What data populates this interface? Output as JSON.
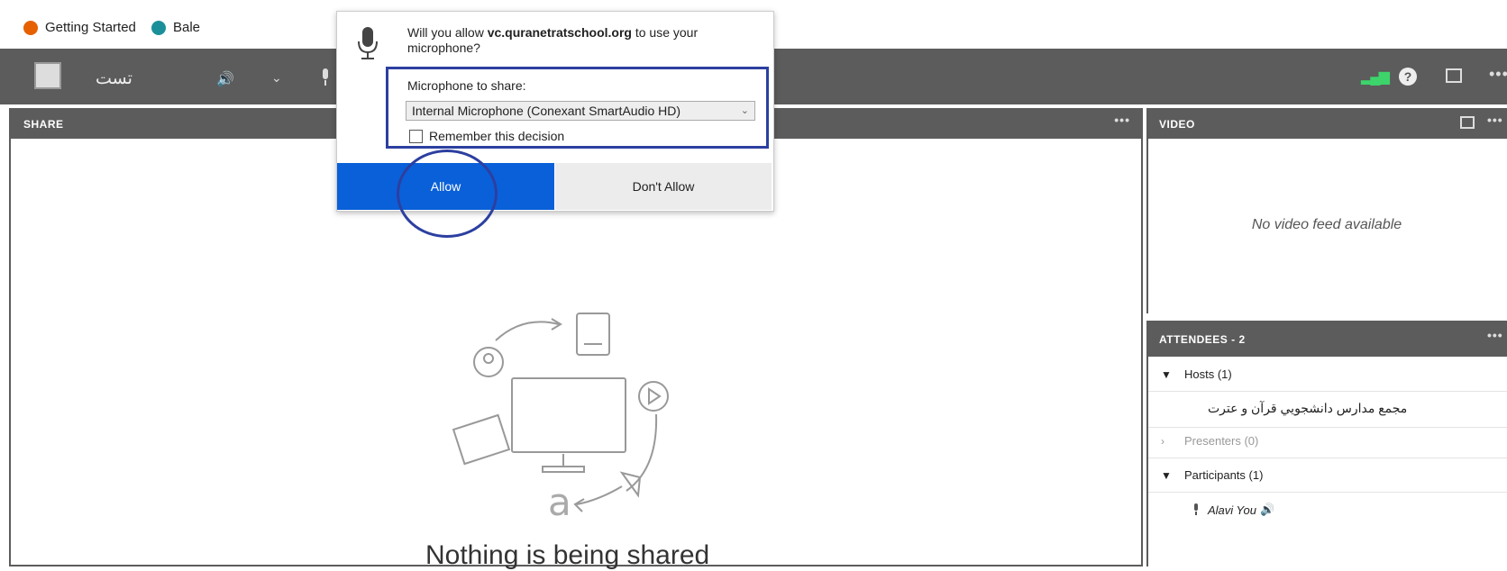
{
  "bookmarks": [
    {
      "label": "Getting Started",
      "icon": "firefox-icon",
      "color": "#e66000"
    },
    {
      "label": "Bale",
      "icon": "bale-icon",
      "color": "#1a8f9a"
    }
  ],
  "toolbar": {
    "meeting_title": "تست",
    "accent_green": "#3cd46b"
  },
  "share_pod": {
    "title": "SHARE",
    "empty_message": "Nothing is being shared"
  },
  "video_pod": {
    "title": "VIDEO",
    "empty_message": "No video feed available"
  },
  "attendees_pod": {
    "title": "ATTENDEES - 2",
    "groups": [
      {
        "label": "Hosts (1)",
        "expanded": true,
        "members": [
          "مجمع مدارس دانشجويي قرآن و عترت"
        ]
      },
      {
        "label": "Presenters (0)",
        "expanded": false,
        "members": []
      },
      {
        "label": "Participants (1)",
        "expanded": true,
        "members": [
          "Alavi You"
        ]
      }
    ]
  },
  "dialog": {
    "question_prefix": "Will you allow ",
    "host": "vc.quranetratschool.org",
    "question_suffix": " to use your microphone?",
    "microphone_label": "Microphone to share:",
    "selected_microphone": "Internal Microphone (Conexant SmartAudio HD)",
    "remember_label": "Remember this decision",
    "remember_checked": false,
    "allow_label": "Allow",
    "dont_allow_label": "Don't Allow",
    "allow_color": "#0a60d8"
  }
}
